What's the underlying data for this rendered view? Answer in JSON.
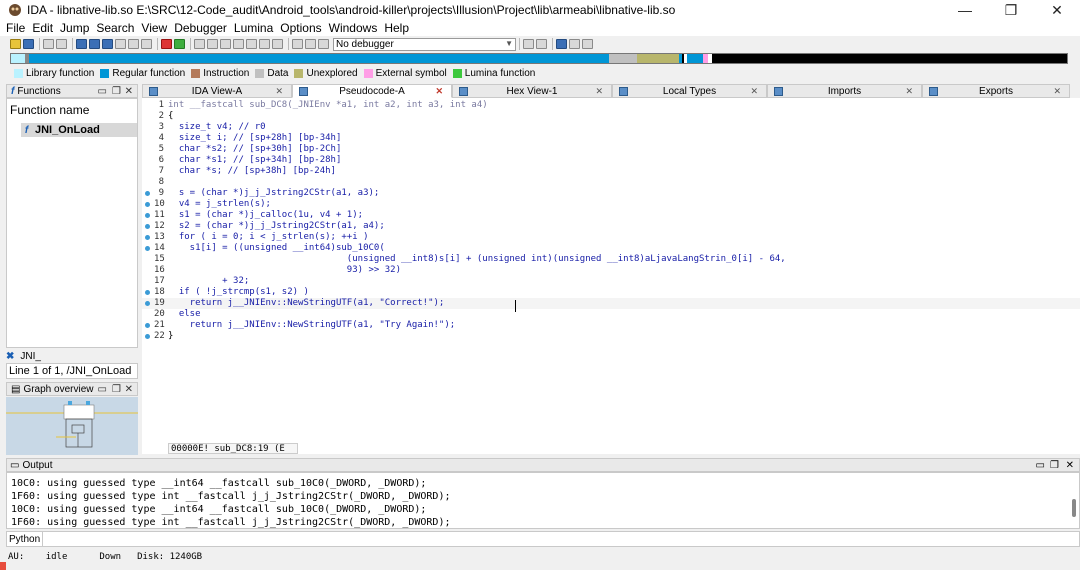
{
  "window": {
    "title": "IDA - libnative-lib.so E:\\SRC\\12-Code_audit\\Android_tools\\android-killer\\projects\\Illusion\\Project\\lib\\armeabi\\libnative-lib.so",
    "minimize": "—",
    "maximize": "❐",
    "close": "✕"
  },
  "menu": [
    "File",
    "Edit",
    "Jump",
    "Search",
    "View",
    "Debugger",
    "Lumina",
    "Options",
    "Windows",
    "Help"
  ],
  "toolbar": {
    "debugger": "No debugger"
  },
  "legend": [
    {
      "label": "Library function",
      "color": "#b9f2ff"
    },
    {
      "label": "Regular function",
      "color": "#0096d6"
    },
    {
      "label": "Instruction",
      "color": "#b47a5a"
    },
    {
      "label": "Data",
      "color": "#c0c0c0"
    },
    {
      "label": "Unexplored",
      "color": "#b8b66c"
    },
    {
      "label": "External symbol",
      "color": "#ff9ee6"
    },
    {
      "label": "Lumina function",
      "color": "#3cc83c"
    }
  ],
  "functions": {
    "title": "Functions",
    "column": "Function name",
    "item": "JNI_OnLoad",
    "filter": "JNI_",
    "status": "Line 1 of 1, /JNI_OnLoad"
  },
  "graph": {
    "title": "Graph overview"
  },
  "tabs": [
    "IDA View-A",
    "Pseudocode-A",
    "Hex View-1",
    "Local Types",
    "Imports",
    "Exports"
  ],
  "code": {
    "lines": [
      {
        "n": "1",
        "text": "int __fastcall sub_DC8(_JNIEnv *a1, int a2, int a3, int a4)"
      },
      {
        "n": "2",
        "text": "{"
      },
      {
        "n": "3",
        "text": "  size_t v4; // r0"
      },
      {
        "n": "4",
        "text": "  size_t i; // [sp+28h] [bp-34h]"
      },
      {
        "n": "5",
        "text": "  char *s2; // [sp+30h] [bp-2Ch]"
      },
      {
        "n": "6",
        "text": "  char *s1; // [sp+34h] [bp-28h]"
      },
      {
        "n": "7",
        "text": "  char *s; // [sp+38h] [bp-24h]"
      },
      {
        "n": "8",
        "text": ""
      },
      {
        "n": "9",
        "text": "  s = (char *)j_j_Jstring2CStr(a1, a3);"
      },
      {
        "n": "10",
        "text": "  v4 = j_strlen(s);"
      },
      {
        "n": "11",
        "text": "  s1 = (char *)j_calloc(1u, v4 + 1);"
      },
      {
        "n": "12",
        "text": "  s2 = (char *)j_j_Jstring2CStr(a1, a4);"
      },
      {
        "n": "13",
        "text": "  for ( i = 0; i < j_strlen(s); ++i )"
      },
      {
        "n": "14",
        "text": "    s1[i] = ((unsigned __int64)sub_10C0("
      },
      {
        "n": "15",
        "text": "                                 (unsigned __int8)s[i] + (unsigned int)(unsigned __int8)aLjavaLangStrin_0[i] - 64,"
      },
      {
        "n": "16",
        "text": "                                 93) >> 32)"
      },
      {
        "n": "17",
        "text": "          + 32;"
      },
      {
        "n": "18",
        "text": "  if ( !j_strcmp(s1, s2) )"
      },
      {
        "n": "19",
        "text": "    return j__JNIEnv::NewStringUTF(a1, \"Correct!\");"
      },
      {
        "n": "20",
        "text": "  else"
      },
      {
        "n": "21",
        "text": "    return j__JNIEnv::NewStringUTF(a1, \"Try Again!\");"
      },
      {
        "n": "22",
        "text": "}"
      }
    ],
    "status": "00000E! sub_DC8:19 (E"
  },
  "output": {
    "title": "Output",
    "lines": [
      "10C0: using guessed type __int64 __fastcall sub_10C0(_DWORD, _DWORD);",
      "1F60: using guessed type int __fastcall j_j_Jstring2CStr(_DWORD, _DWORD);",
      "10C0: using guessed type __int64 __fastcall sub_10C0(_DWORD, _DWORD);",
      "1F60: using guessed type int __fastcall j_j_Jstring2CStr(_DWORD, _DWORD);"
    ]
  },
  "python": {
    "label": "Python"
  },
  "status": {
    "au": "AU:",
    "state": "idle",
    "dir": "Down",
    "disk": "Disk: 1240GB"
  }
}
